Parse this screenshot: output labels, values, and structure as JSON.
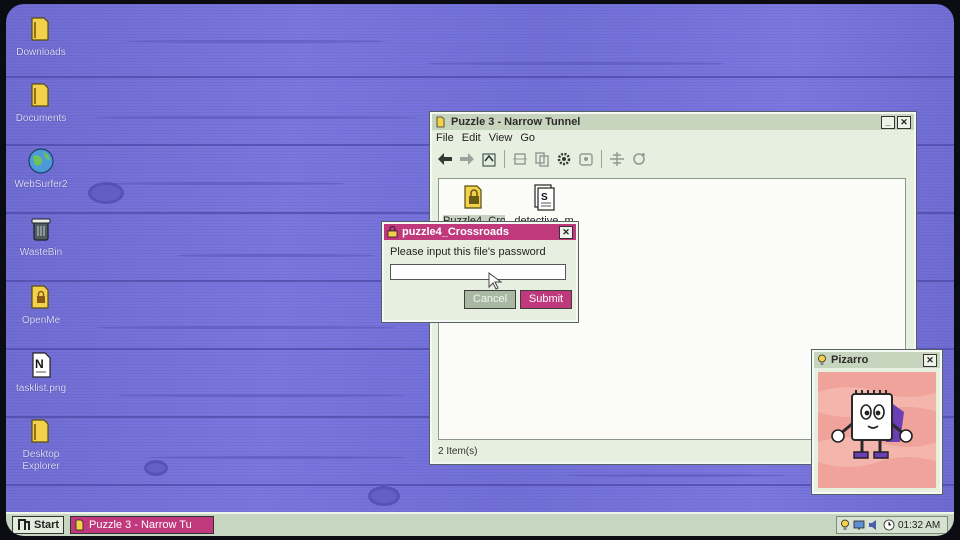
{
  "desktop": {
    "icons": [
      {
        "label": "Downloads",
        "icon": "folder-icon"
      },
      {
        "label": "Documents",
        "icon": "folder-icon"
      },
      {
        "label": "WebSurfer2",
        "icon": "globe-icon"
      },
      {
        "label": "WasteBin",
        "icon": "trash-icon"
      },
      {
        "label": "OpenMe",
        "icon": "folder-lock-icon"
      },
      {
        "label": "tasklist.png",
        "icon": "image-file-icon"
      },
      {
        "label": "Desktop Explorer",
        "icon": "folder-icon"
      }
    ]
  },
  "explorer": {
    "title": "Puzzle 3 - Narrow Tunnel",
    "menu": [
      "File",
      "Edit",
      "View",
      "Go"
    ],
    "files": [
      {
        "label": "Puzzle4_Cro",
        "icon": "locked-folder-icon"
      },
      {
        "label": "detective_m",
        "icon": "document-icon"
      }
    ],
    "status": "2 Item(s)"
  },
  "dialog": {
    "title": "puzzle4_Crossroads",
    "prompt": "Please input this file's password",
    "input_value": "",
    "cancel_label": "Cancel",
    "submit_label": "Submit"
  },
  "assistant": {
    "title": "Pizarro"
  },
  "taskbar": {
    "start_label": "Start",
    "active_task": "Puzzle 3 - Narrow Tu",
    "clock": "01:32 AM"
  },
  "colors": {
    "desktop": "#7572da",
    "accent_pink": "#c0397d",
    "window_bg": "#e7efe0",
    "button_green": "#a9b8a2"
  }
}
